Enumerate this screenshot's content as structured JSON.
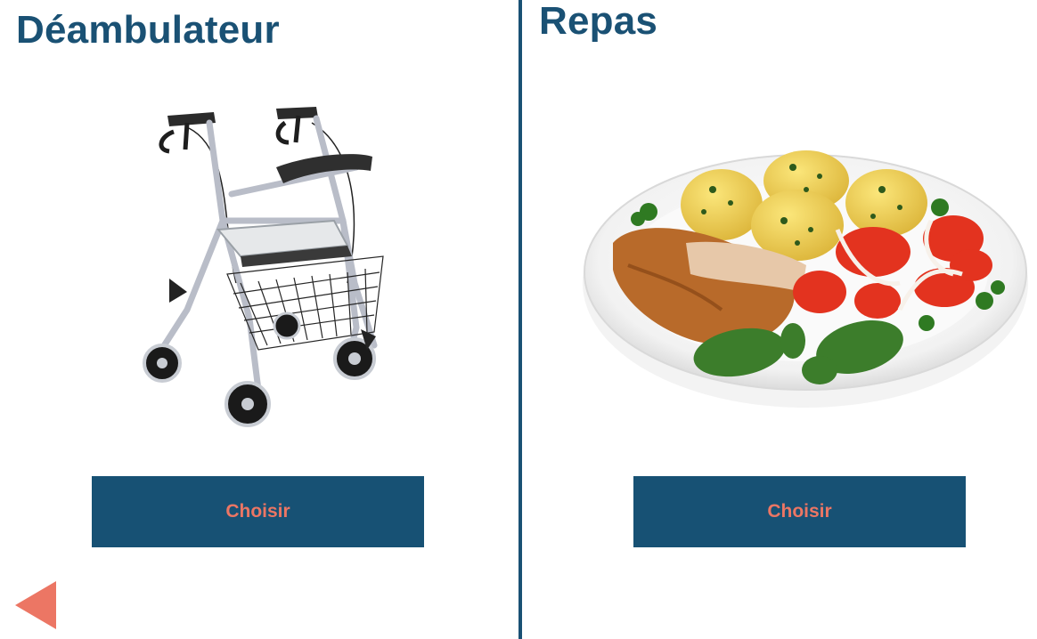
{
  "left_panel": {
    "title": "Déambulateur",
    "image": "walker-rollator",
    "button_label": "Choisir"
  },
  "right_panel": {
    "title": "Repas",
    "image": "meal-plate",
    "button_label": "Choisir"
  },
  "navigation": {
    "back_icon": "back-arrow-icon"
  },
  "colors": {
    "primary": "#1a5174",
    "accent": "#ec7664",
    "background": "#ffffff"
  }
}
